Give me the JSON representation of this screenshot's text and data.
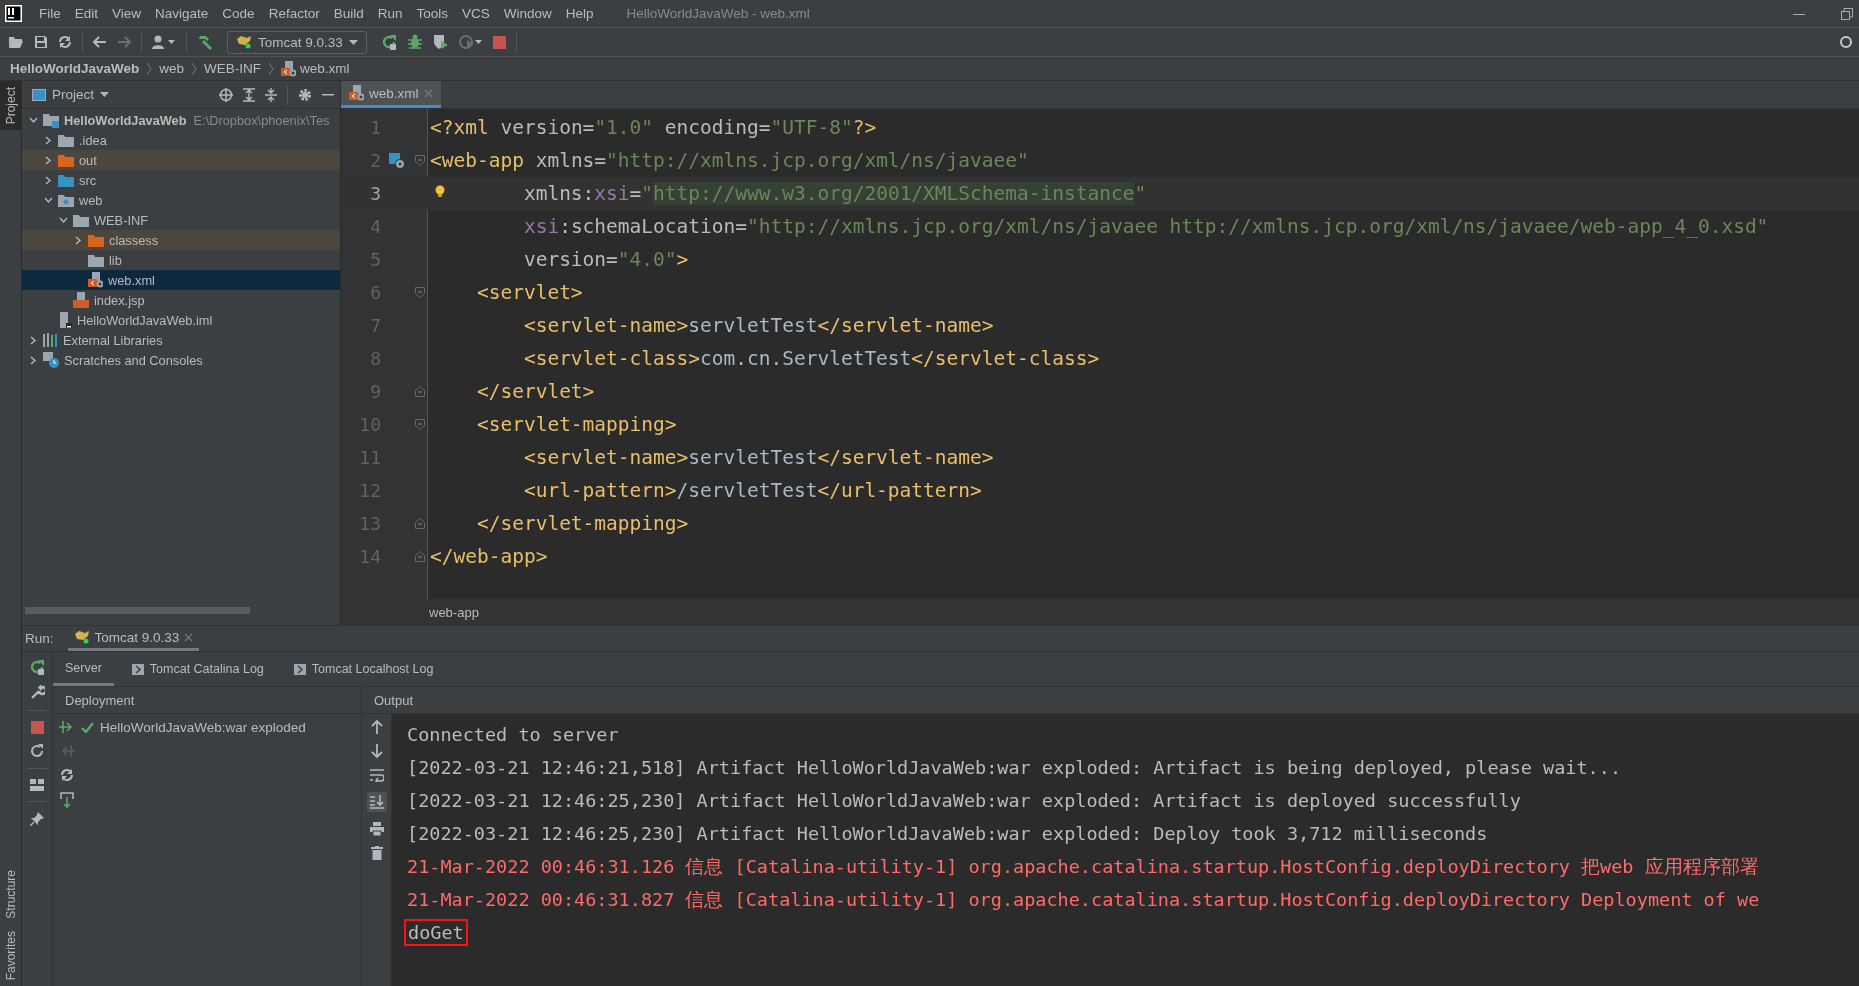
{
  "window": {
    "title": "HelloWorldJavaWeb - web.xml"
  },
  "menu": [
    "File",
    "Edit",
    "View",
    "Navigate",
    "Code",
    "Refactor",
    "Build",
    "Run",
    "Tools",
    "VCS",
    "Window",
    "Help"
  ],
  "toolbar": {
    "run_config": "Tomcat 9.0.33"
  },
  "breadcrumb": [
    {
      "label": "HelloWorldJavaWeb",
      "kind": "project"
    },
    {
      "label": "web",
      "kind": "folder"
    },
    {
      "label": "WEB-INF",
      "kind": "folder"
    },
    {
      "label": "web.xml",
      "kind": "xml"
    }
  ],
  "tool_stripe_top": [
    {
      "label": "Project",
      "selected": true
    }
  ],
  "tool_stripe_bottom": [
    {
      "label": "Structure",
      "selected": false
    },
    {
      "label": "Favorites",
      "selected": false
    }
  ],
  "project_panel": {
    "title": "Project",
    "tree": [
      {
        "label": "HelloWorldJavaWeb",
        "path": "E:\\Dropbox\\phoenix\\Tes",
        "kind": "module",
        "expanded": true,
        "selected": false,
        "excluded": false,
        "children": [
          {
            "label": ".idea",
            "kind": "folder",
            "expanded": false,
            "selected": false,
            "excluded": false
          },
          {
            "label": "out",
            "kind": "folder-excluded",
            "expanded": false,
            "selected": false,
            "excluded": true
          },
          {
            "label": "src",
            "kind": "folder-source",
            "expanded": false,
            "selected": false,
            "excluded": false
          },
          {
            "label": "web",
            "kind": "folder-web",
            "expanded": true,
            "selected": false,
            "excluded": false,
            "children": [
              {
                "label": "WEB-INF",
                "kind": "folder",
                "expanded": true,
                "selected": false,
                "excluded": false,
                "children": [
                  {
                    "label": "classess",
                    "kind": "folder-excluded",
                    "expanded": false,
                    "selected": false,
                    "excluded": true
                  },
                  {
                    "label": "lib",
                    "kind": "folder",
                    "selected": false,
                    "excluded": false
                  },
                  {
                    "label": "web.xml",
                    "kind": "xml",
                    "selected": true,
                    "excluded": false
                  }
                ]
              },
              {
                "label": "index.jsp",
                "kind": "jsp",
                "selected": false,
                "excluded": false
              }
            ]
          },
          {
            "label": "HelloWorldJavaWeb.iml",
            "kind": "iml",
            "selected": false,
            "excluded": false
          }
        ]
      },
      {
        "label": "External Libraries",
        "kind": "libraries",
        "expanded": false,
        "selected": false,
        "excluded": false
      },
      {
        "label": "Scratches and Consoles",
        "kind": "scratches",
        "expanded": false,
        "selected": false,
        "excluded": false
      }
    ]
  },
  "editor": {
    "tabs": [
      {
        "label": "web.xml",
        "selected": true
      }
    ],
    "lines": [
      {
        "number": "1",
        "tokens": [
          {
            "text": "<?xml",
            "kind": "tag"
          },
          {
            "text": " version=",
            "kind": "attr"
          },
          {
            "text": "\"1.0\"",
            "kind": "value"
          },
          {
            "text": " encoding=",
            "kind": "attr"
          },
          {
            "text": "\"UTF-8\"",
            "kind": "value"
          },
          {
            "text": "?>",
            "kind": "tag"
          }
        ]
      },
      {
        "number": "2",
        "gutter_icon": true,
        "fold_start": true,
        "tokens": [
          {
            "text": "<web-app",
            "kind": "tag"
          },
          {
            "text": " xmlns=",
            "kind": "attr"
          },
          {
            "text": "\"http://xmlns.jcp.org/xml/ns/javaee\"",
            "kind": "value"
          }
        ]
      },
      {
        "number": "3",
        "current": true,
        "bulb": true,
        "tokens": [
          {
            "text": "        xmlns:",
            "kind": "attr"
          },
          {
            "text": "xsi",
            "kind": "ns"
          },
          {
            "text": "=",
            "kind": "attr"
          },
          {
            "text": "\"",
            "kind": "value"
          },
          {
            "text": "http://www.w3.org/2001/XMLSchema-instance",
            "kind": "value-marked"
          },
          {
            "text": "\"",
            "kind": "value"
          }
        ]
      },
      {
        "number": "4",
        "tokens": [
          {
            "text": "        xsi",
            "kind": "ns"
          },
          {
            "text": ":schemaLocation=",
            "kind": "attr"
          },
          {
            "text": "\"http://xmlns.jcp.org/xml/ns/javaee http://xmlns.jcp.org/xml/ns/javaee/web-app_4_0.xsd\"",
            "kind": "value"
          }
        ]
      },
      {
        "number": "5",
        "tokens": [
          {
            "text": "        version=",
            "kind": "attr"
          },
          {
            "text": "\"4.0\"",
            "kind": "value"
          },
          {
            "text": ">",
            "kind": "tag"
          }
        ]
      },
      {
        "number": "6",
        "fold_start": true,
        "tokens": [
          {
            "text": "    <servlet>",
            "kind": "tag"
          }
        ]
      },
      {
        "number": "7",
        "tokens": [
          {
            "text": "        <servlet-name>",
            "kind": "tag"
          },
          {
            "text": "servletTest",
            "kind": "text"
          },
          {
            "text": "</servlet-name>",
            "kind": "tag"
          }
        ]
      },
      {
        "number": "8",
        "tokens": [
          {
            "text": "        <servlet-class>",
            "kind": "tag"
          },
          {
            "text": "com.cn.ServletTest",
            "kind": "text"
          },
          {
            "text": "</servlet-class>",
            "kind": "tag"
          }
        ]
      },
      {
        "number": "9",
        "fold_end": true,
        "tokens": [
          {
            "text": "    </servlet>",
            "kind": "tag"
          }
        ]
      },
      {
        "number": "10",
        "fold_start": true,
        "tokens": [
          {
            "text": "    <servlet-mapping>",
            "kind": "tag"
          }
        ]
      },
      {
        "number": "11",
        "tokens": [
          {
            "text": "        <servlet-name>",
            "kind": "tag"
          },
          {
            "text": "servletTest",
            "kind": "text"
          },
          {
            "text": "</servlet-name>",
            "kind": "tag"
          }
        ]
      },
      {
        "number": "12",
        "tokens": [
          {
            "text": "        <url-pattern>",
            "kind": "tag"
          },
          {
            "text": "/servletTest",
            "kind": "text"
          },
          {
            "text": "</url-pattern>",
            "kind": "tag"
          }
        ]
      },
      {
        "number": "13",
        "fold_end": true,
        "tokens": [
          {
            "text": "    </servlet-mapping>",
            "kind": "tag"
          }
        ]
      },
      {
        "number": "14",
        "fold_end": true,
        "tokens": [
          {
            "text": "</web-app>",
            "kind": "tag"
          }
        ]
      }
    ],
    "breadcrumb": "web-app"
  },
  "run_panel": {
    "label": "Run:",
    "tabs": [
      {
        "label": "Tomcat 9.0.33",
        "selected": true
      }
    ],
    "subtabs": [
      {
        "label": "Server",
        "kind": "plain",
        "selected": true
      },
      {
        "label": "Tomcat Catalina Log",
        "kind": "log",
        "selected": false
      },
      {
        "label": "Tomcat Localhost Log",
        "kind": "log",
        "selected": false
      }
    ],
    "deployment_header": "Deployment",
    "output_header": "Output",
    "deployments": [
      {
        "label": "HelloWorldJavaWeb:war exploded",
        "deployed": true
      }
    ],
    "output": [
      {
        "text": "Connected to server",
        "kind": "info",
        "boxed": false
      },
      {
        "text": "[2022-03-21 12:46:21,518] Artifact HelloWorldJavaWeb:war exploded: Artifact is being deployed, please wait...",
        "kind": "info",
        "boxed": false
      },
      {
        "text": "[2022-03-21 12:46:25,230] Artifact HelloWorldJavaWeb:war exploded: Artifact is deployed successfully",
        "kind": "info",
        "boxed": false
      },
      {
        "text": "[2022-03-21 12:46:25,230] Artifact HelloWorldJavaWeb:war exploded: Deploy took 3,712 milliseconds",
        "kind": "info",
        "boxed": false
      },
      {
        "text": "21-Mar-2022 00:46:31.126 信息 [Catalina-utility-1] org.apache.catalina.startup.HostConfig.deployDirectory 把web 应用程序部署",
        "kind": "error",
        "boxed": false
      },
      {
        "text": "21-Mar-2022 00:46:31.827 信息 [Catalina-utility-1] org.apache.catalina.startup.HostConfig.deployDirectory Deployment of we",
        "kind": "error",
        "boxed": false
      },
      {
        "text": "doGet",
        "kind": "info",
        "boxed": true
      }
    ]
  }
}
